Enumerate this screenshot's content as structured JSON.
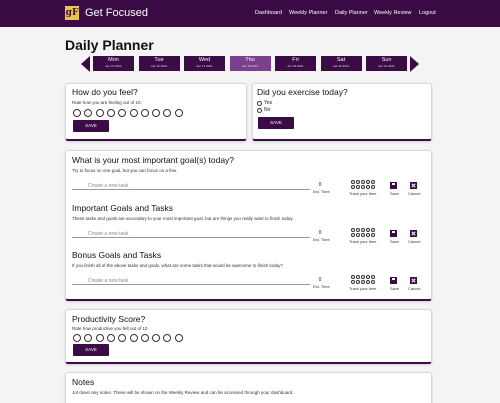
{
  "brand": {
    "logo": "gF",
    "name": "Get Focused"
  },
  "nav": [
    "Dashboard",
    "Weekly Planner",
    "Daily Planner",
    "Weekly Review",
    "Logout"
  ],
  "page_title": "Daily Planner",
  "week": [
    {
      "day": "Mon",
      "date": "Apr 15 2021"
    },
    {
      "day": "Tue",
      "date": "Apr 16 2021"
    },
    {
      "day": "Wed",
      "date": "Apr 17 2021"
    },
    {
      "day": "Thu",
      "date": "Apr 18 2021"
    },
    {
      "day": "Fri",
      "date": "Apr 19 2021"
    },
    {
      "day": "Sat",
      "date": "Apr 20 2021"
    },
    {
      "day": "Sun",
      "date": "Apr 21 2021"
    }
  ],
  "active_day": "Thu",
  "feel": {
    "title": "How do you feel?",
    "subtitle": "Rate how you are feeling out of 10.",
    "save": "SAVE"
  },
  "exercise": {
    "title": "Did you exercise today?",
    "options": [
      "Yes",
      "No"
    ],
    "save": "SAVE"
  },
  "goals": {
    "title": "What is your most important goal(s) today?",
    "subtitle": "Try to focus on one goal, but you can focus on a few.",
    "placeholder": "Create a new task",
    "est": "0",
    "est_label": "Est. Time",
    "track_label": "Track your time",
    "save": "Save",
    "cancel": "Cancel"
  },
  "important": {
    "title": "Important Goals and Tasks",
    "subtitle": "These tasks and goals are secondary to your most important goal, but are things you really want to finish today.",
    "placeholder": "Create a new task",
    "est": "0",
    "est_label": "Est. Time",
    "track_label": "Track your time",
    "save": "Save",
    "cancel": "Cancel"
  },
  "bonus": {
    "title": "Bonus Goals and Tasks",
    "subtitle": "If you finish all of the above tasks and goals, what are some tasks that would be awesome to finish today?",
    "placeholder": "Create a new task",
    "est": "0",
    "est_label": "Est. Time",
    "track_label": "Track your time",
    "save": "Save",
    "cancel": "Cancel"
  },
  "productivity": {
    "title": "Productivity Score?",
    "subtitle": "Rate how productive you felt out of 10.",
    "save": "SAVE"
  },
  "notes": {
    "title": "Notes",
    "subtitle": "Jot down any notes. These will be shown on the Weekly Review and can be accessed through your dashboard."
  },
  "colors": {
    "primary": "#3a0b45",
    "active_day": "#7b3f8d",
    "logo": "#e8c64a"
  }
}
